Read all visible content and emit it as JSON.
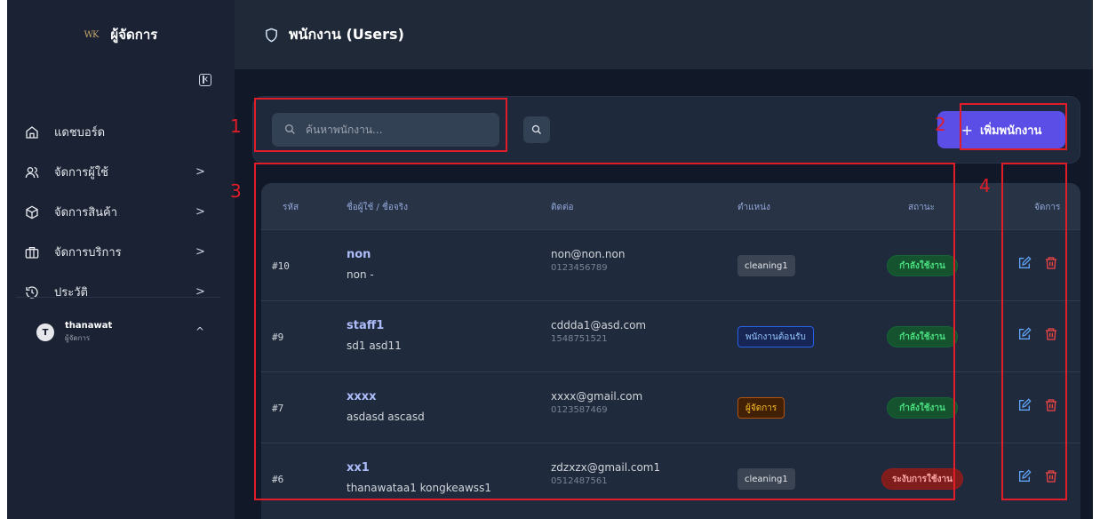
{
  "brand": {
    "logo_text": "WK",
    "title": "ผู้จัดการ"
  },
  "sidebar": {
    "items": [
      {
        "label": "แดชบอร์ด",
        "icon": "home-icon",
        "has_chevron": false
      },
      {
        "label": "จัดการผู้ใช้",
        "icon": "users-icon",
        "has_chevron": true
      },
      {
        "label": "จัดการสินค้า",
        "icon": "box-icon",
        "has_chevron": true
      },
      {
        "label": "จัดการบริการ",
        "icon": "briefcase-icon",
        "has_chevron": true
      },
      {
        "label": "ประวัติ",
        "icon": "history-icon",
        "has_chevron": true
      }
    ],
    "chevron": ">",
    "user": {
      "initial": "T",
      "name": "thanawat",
      "role": "ผู้จัดการ",
      "chevron": "^"
    }
  },
  "header": {
    "title": "พนักงาน (Users)",
    "icon": "shield-icon"
  },
  "toolbar": {
    "search_placeholder": "ค้นหาพนักงาน...",
    "add_label": "เพิ่มพนักงาน",
    "add_plus": "+"
  },
  "table": {
    "columns": [
      "รหัส",
      "ชื่อผู้ใช้ / ชื่อจริง",
      "ติดต่อ",
      "ตำแหน่ง",
      "สถานะ",
      "จัดการ"
    ],
    "rows": [
      {
        "id": "#10",
        "username": "non",
        "fullname": "non -",
        "email": "non@non.non",
        "phone": "0123456789",
        "role": "cleaning1",
        "role_style": "gray",
        "status": "กำลังใช้งาน",
        "status_style": "active"
      },
      {
        "id": "#9",
        "username": "staff1",
        "fullname": "sd1 asd11",
        "email": "cddda1@asd.com",
        "phone": "1548751521",
        "role": "พนักงานต้อนรับ",
        "role_style": "blue",
        "status": "กำลังใช้งาน",
        "status_style": "active"
      },
      {
        "id": "#7",
        "username": "xxxx",
        "fullname": "asdasd ascasd",
        "email": "xxxx@gmail.com",
        "phone": "0123587469",
        "role": "ผู้จัดการ",
        "role_style": "yellow",
        "status": "กำลังใช้งาน",
        "status_style": "active"
      },
      {
        "id": "#6",
        "username": "xx1",
        "fullname": "thanawataa1 kongkeawss1",
        "email": "zdzxzx@gmail.com1",
        "phone": "0512487561",
        "role": "cleaning1",
        "role_style": "gray",
        "status": "ระงับการใช้งาน",
        "status_style": "suspended"
      }
    ]
  },
  "annotations": [
    "1",
    "2",
    "3",
    "4"
  ],
  "colors": {
    "accent": "#5b4ee6",
    "annotation": "#e11d2a",
    "active": "#22c55e",
    "suspended": "#ef4444"
  }
}
